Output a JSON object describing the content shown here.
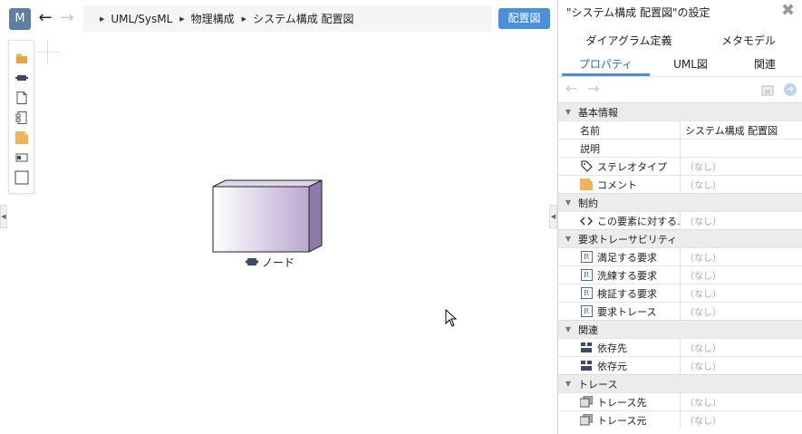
{
  "toolbar": {
    "model_badge": "M",
    "breadcrumb": [
      "UML/SysML",
      "物理構成",
      "システム構成 配置図"
    ],
    "diagram_button": "配置図"
  },
  "canvas": {
    "palette_tools": [
      "package-icon",
      "node-icon",
      "artifact-icon",
      "component-icon",
      "comment-icon",
      "port-icon",
      "frame-icon"
    ],
    "node": {
      "label": "ノード"
    }
  },
  "panel": {
    "title": "\"システム構成 配置図\"の設定",
    "tabs_row1": [
      "ダイアグラム定義",
      "メタモデル"
    ],
    "tabs_row2": [
      "プロパティ",
      "UML図",
      "関連"
    ],
    "active_tab": "プロパティ",
    "sections": [
      {
        "title": "基本情報",
        "rows": [
          {
            "label": "名前",
            "value": "システム構成 配置図"
          },
          {
            "label": "説明",
            "value": ""
          },
          {
            "label": "ステレオタイプ",
            "value": "（なし）",
            "icon": "tag-icon"
          },
          {
            "label": "コメント",
            "value": "（なし）",
            "icon": "comment-icon"
          }
        ]
      },
      {
        "title": "制約",
        "rows": [
          {
            "label": "この要素に対する…",
            "value": "（なし）",
            "icon": "code-icon"
          }
        ]
      },
      {
        "title": "要求トレーサビリティ",
        "rows": [
          {
            "label": "満足する要求",
            "value": "（なし）",
            "icon": "requirement-icon"
          },
          {
            "label": "洗練する要求",
            "value": "（なし）",
            "icon": "requirement-icon"
          },
          {
            "label": "検証する要求",
            "value": "（なし）",
            "icon": "requirement-icon"
          },
          {
            "label": "要求トレース",
            "value": "（なし）",
            "icon": "requirement-icon"
          }
        ]
      },
      {
        "title": "関連",
        "rows": [
          {
            "label": "依存先",
            "value": "（なし）",
            "icon": "dependency-icon"
          },
          {
            "label": "依存元",
            "value": "（なし）",
            "icon": "dependency-icon"
          }
        ]
      },
      {
        "title": "トレース",
        "rows": [
          {
            "label": "トレース先",
            "value": "（なし）",
            "icon": "trace-icon"
          },
          {
            "label": "トレース元",
            "value": "（なし）",
            "icon": "trace-icon"
          }
        ]
      }
    ]
  },
  "colors": {
    "accent": "#4a90d9",
    "badge": "#5d7fa3",
    "node_fill": "#b9a9d0"
  }
}
